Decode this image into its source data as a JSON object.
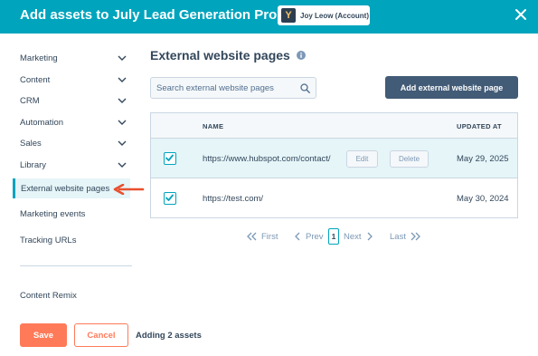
{
  "header": {
    "title": "Add assets to July Lead Generation Promo",
    "account_logo_text": "Y",
    "account_name": "Joy Leow (Account)",
    "close_icon": "close-icon"
  },
  "sidebar": {
    "items": [
      {
        "label": "Marketing",
        "icon": "chevron-down-icon"
      },
      {
        "label": "Content",
        "icon": "chevron-down-icon"
      },
      {
        "label": "CRM",
        "icon": "chevron-down-icon"
      },
      {
        "label": "Automation",
        "icon": "chevron-down-icon"
      },
      {
        "label": "Sales",
        "icon": "chevron-down-icon"
      },
      {
        "label": "Library",
        "icon": "chevron-down-icon"
      }
    ],
    "active_item": "External website pages",
    "links": [
      "Marketing events",
      "Tracking URLs"
    ],
    "footer_item": "Content Remix"
  },
  "main": {
    "title": "External website pages",
    "search_placeholder": "Search external website pages",
    "add_button": "Add external website page",
    "table": {
      "columns": [
        "NAME",
        "UPDATED AT"
      ],
      "rows": [
        {
          "checked": true,
          "name": "https://www.hubspot.com/contact/",
          "edit": "Edit",
          "delete": "Delete",
          "updated": "May 29, 2025"
        },
        {
          "checked": true,
          "name": "https://test.com/",
          "updated": "May 30, 2024"
        }
      ]
    },
    "pagination": {
      "first": "First",
      "prev": "Prev",
      "page": "1",
      "next": "Next",
      "last": "Last"
    }
  },
  "footer": {
    "save": "Save",
    "cancel": "Cancel",
    "status": "Adding 2 assets"
  },
  "colors": {
    "header": "#00a4bd",
    "primary_button": "#ff7a59",
    "secondary_button": "#425b76",
    "text": "#33475b"
  }
}
